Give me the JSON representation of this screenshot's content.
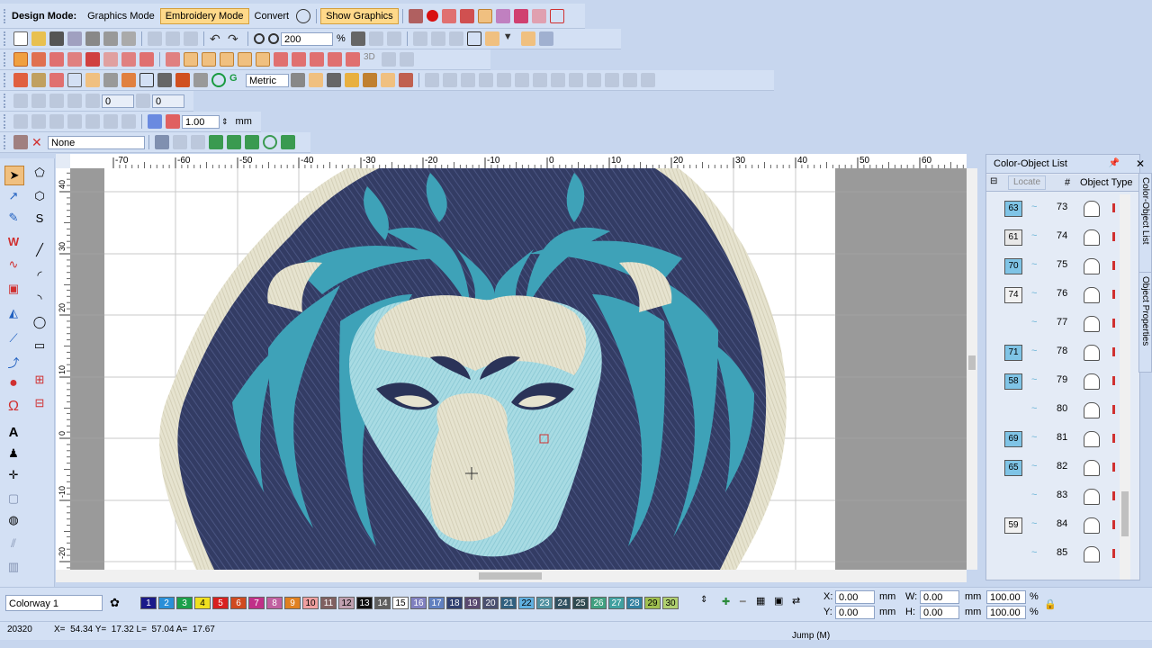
{
  "toolbar1": {
    "design_mode_label": "Design Mode:",
    "graphics_mode": "Graphics Mode",
    "embroidery_mode": "Embroidery Mode",
    "convert": "Convert",
    "show_graphics": "Show Graphics"
  },
  "toolbar2": {
    "zoom_value": "200",
    "zoom_unit": "%"
  },
  "toolbar4": {
    "units": "Metric"
  },
  "toolbar5": {
    "field1": "0",
    "field2": "0"
  },
  "toolbar6": {
    "scale_value": "1.00",
    "unit": "mm"
  },
  "toolbar7": {
    "applique": "None"
  },
  "hruler_labels": [
    "-70",
    "-60",
    "-50",
    "-40",
    "-30",
    "-20",
    "-10",
    "0",
    "10",
    "20",
    "30",
    "40",
    "50",
    "60"
  ],
  "vruler_labels": [
    "40",
    "30",
    "20",
    "10",
    "0",
    "-10",
    "-20"
  ],
  "panel": {
    "title": "Color-Object List",
    "locate": "Locate",
    "hash": "#",
    "object_type": "Object Type",
    "side_tab1": "Color-Object List",
    "side_tab2": "Object Properties",
    "rows": [
      {
        "color": "63",
        "num": "73",
        "color_bg": "#7fc4e6"
      },
      {
        "color": "61",
        "num": "74",
        "color_bg": "#e8e8e8"
      },
      {
        "color": "70",
        "num": "75",
        "color_bg": "#7fc4e6"
      },
      {
        "color": "74",
        "num": "76",
        "color_bg": "#f2f2f2"
      },
      {
        "color": "",
        "num": "77",
        "color_bg": ""
      },
      {
        "color": "71",
        "num": "78",
        "color_bg": "#7fc4e6"
      },
      {
        "color": "58",
        "num": "79",
        "color_bg": "#7fc4e6"
      },
      {
        "color": "",
        "num": "80",
        "color_bg": ""
      },
      {
        "color": "69",
        "num": "81",
        "color_bg": "#7fc4e6"
      },
      {
        "color": "65",
        "num": "82",
        "color_bg": "#7fc4e6"
      },
      {
        "color": "",
        "num": "83",
        "color_bg": ""
      },
      {
        "color": "59",
        "num": "84",
        "color_bg": "#f2f2f2"
      },
      {
        "color": "",
        "num": "85",
        "color_bg": ""
      }
    ]
  },
  "bottom": {
    "colorway": "Colorway 1",
    "swatches": [
      {
        "n": "1",
        "c": "#1a1a8a",
        "t": "#fff"
      },
      {
        "n": "2",
        "c": "#2a8fd8",
        "t": "#fff"
      },
      {
        "n": "3",
        "c": "#1aa04a",
        "t": "#fff"
      },
      {
        "n": "4",
        "c": "#f0e020",
        "t": "#000"
      },
      {
        "n": "5",
        "c": "#d82020",
        "t": "#fff"
      },
      {
        "n": "6",
        "c": "#d04a20",
        "t": "#fff"
      },
      {
        "n": "7",
        "c": "#c03088",
        "t": "#fff"
      },
      {
        "n": "8",
        "c": "#c060a0",
        "t": "#fff"
      },
      {
        "n": "9",
        "c": "#e08020",
        "t": "#fff"
      },
      {
        "n": "10",
        "c": "#f0a0a0",
        "t": "#000"
      },
      {
        "n": "11",
        "c": "#806060",
        "t": "#fff"
      },
      {
        "n": "12",
        "c": "#c0a0b0",
        "t": "#000"
      },
      {
        "n": "13",
        "c": "#101010",
        "t": "#fff"
      },
      {
        "n": "14",
        "c": "#606060",
        "t": "#fff"
      },
      {
        "n": "15",
        "c": "#ffffff",
        "t": "#000"
      },
      {
        "n": "16",
        "c": "#8080c0",
        "t": "#fff"
      },
      {
        "n": "17",
        "c": "#6080c0",
        "t": "#fff"
      },
      {
        "n": "18",
        "c": "#304070",
        "t": "#fff"
      },
      {
        "n": "19",
        "c": "#5a4a70",
        "t": "#fff"
      },
      {
        "n": "20",
        "c": "#4a5070",
        "t": "#fff"
      },
      {
        "n": "21",
        "c": "#306080",
        "t": "#fff"
      },
      {
        "n": "22",
        "c": "#60b0e0",
        "t": "#000"
      },
      {
        "n": "23",
        "c": "#5090a0",
        "t": "#fff"
      },
      {
        "n": "24",
        "c": "#305060",
        "t": "#fff"
      },
      {
        "n": "25",
        "c": "#304a50",
        "t": "#fff"
      },
      {
        "n": "26",
        "c": "#40a080",
        "t": "#fff"
      },
      {
        "n": "27",
        "c": "#40a0a0",
        "t": "#fff"
      },
      {
        "n": "28",
        "c": "#3080a0",
        "t": "#fff"
      },
      {
        "n": "29",
        "c": "#a0c050",
        "t": "#000"
      },
      {
        "n": "30",
        "c": "#b0d070",
        "t": "#000"
      }
    ],
    "x_label": "X:",
    "x_value": "0.00",
    "y_label": "Y:",
    "y_value": "0.00",
    "w_label": "W:",
    "w_value": "0.00",
    "h_label": "H:",
    "h_value": "0.00",
    "unit": "mm",
    "pct_w": "100.00",
    "pct_h": "100.00",
    "pct": "%"
  },
  "status": {
    "stitches": "20320",
    "coords": "X=  54.34 Y=  17.32 L=  57.04 A=  17.67",
    "command": "Jump (M)"
  }
}
